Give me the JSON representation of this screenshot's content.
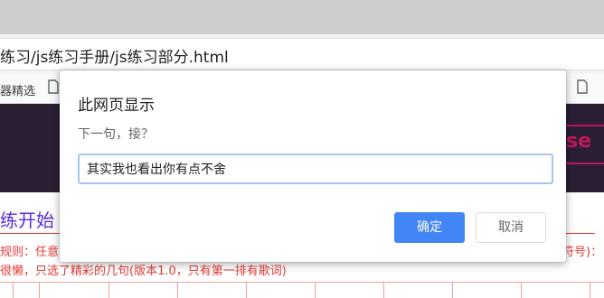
{
  "browser": {
    "url": "练习/js练习手册/js练习部分.html",
    "bookmarks": [
      {
        "label": "器精选"
      }
    ]
  },
  "page": {
    "heading": "练开始",
    "badge_text": "se",
    "rule_line_1": "规则：任意",
    "rule_line_1_end": "符号)：",
    "rule_line_2": "很懒，只选了精彩的几句(版本1.0，只有第一排有歌词)"
  },
  "dialog": {
    "title": "此网页显示",
    "message": "下一句，接？",
    "input_value": "其实我也看出你有点不舍",
    "ok_label": "确定",
    "cancel_label": "取消"
  },
  "colors": {
    "accent": "#4285f4",
    "rule_text": "#e53935",
    "heading": "#5b2be0",
    "page_bar": "#2a1f33"
  }
}
